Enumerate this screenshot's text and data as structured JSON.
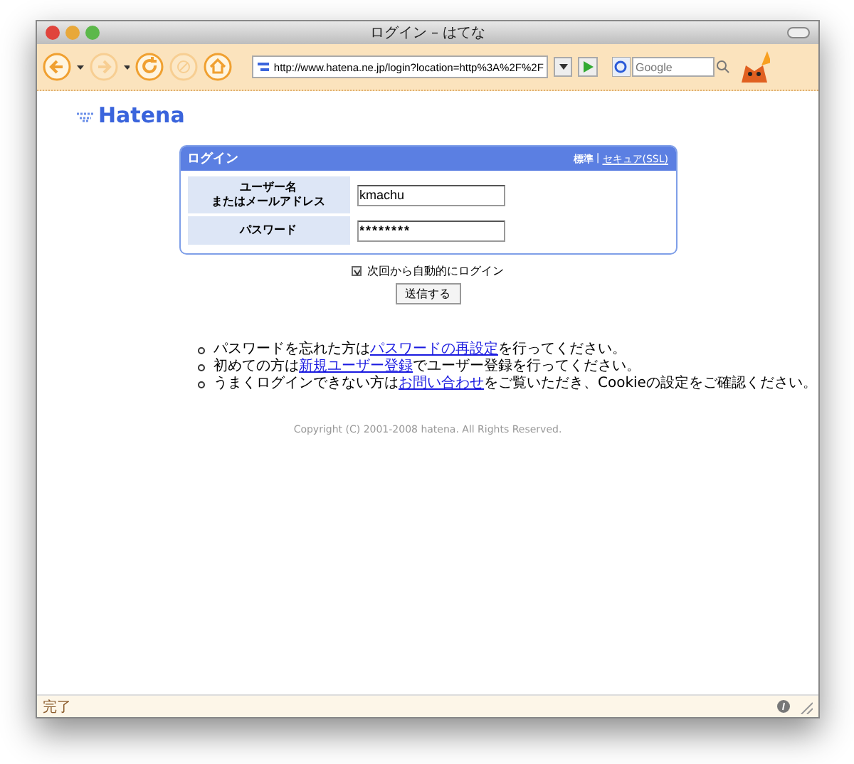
{
  "window": {
    "title": "ログイン – はてな"
  },
  "toolbar": {
    "url": "http://www.hatena.ne.jp/login?location=http%3A%2F%2F",
    "search": {
      "placeholder": "Google"
    }
  },
  "logo": "Hatena",
  "login": {
    "title": "ログイン",
    "separator": "|",
    "mode_links": [
      {
        "label": "標準",
        "selected": true
      },
      {
        "label": "セキュア(SSL)",
        "selected": false
      }
    ],
    "fields": [
      {
        "label_lines": [
          "ユーザー名",
          "またはメールアドレス"
        ],
        "value": "kmachu",
        "kind": "text"
      },
      {
        "label_lines": [
          "パスワード"
        ],
        "value": "********",
        "kind": "password"
      }
    ],
    "remember": {
      "label": "次回から自動的にログイン",
      "checked": true
    },
    "submit": "送信する"
  },
  "notes": [
    {
      "before": "パスワードを忘れた方は",
      "link": "パスワードの再設定",
      "after": "を行ってください。"
    },
    {
      "before": "初めての方は",
      "link": "新規ユーザー登録",
      "after": "でユーザー登録を行ってください。"
    },
    {
      "before": "うまくログインできない方は",
      "link": "お問い合わせ",
      "after": "をご覧いただき、Cookieの設定をご確認ください。"
    }
  ],
  "copyright": "Copyright (C) 2001-2008 hatena. All Rights Reserved.",
  "status_bar": {
    "text": "完了"
  }
}
